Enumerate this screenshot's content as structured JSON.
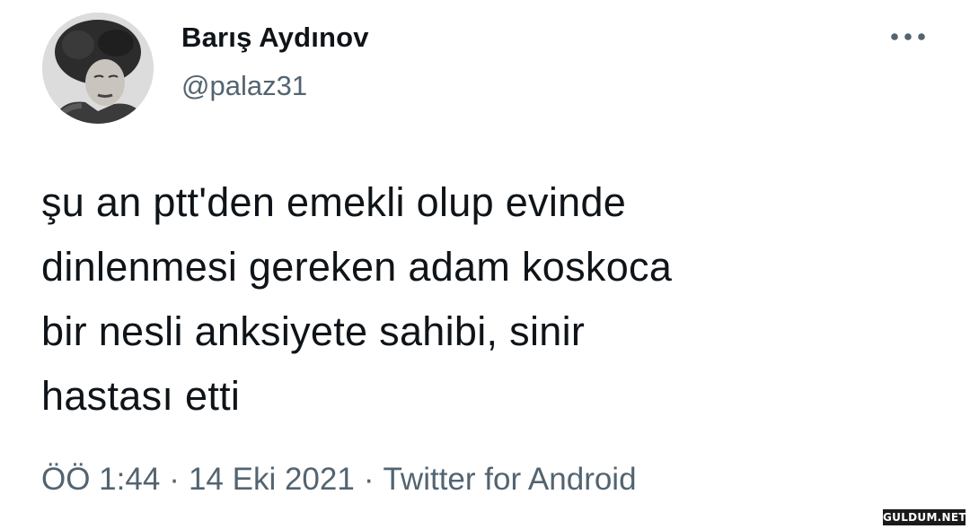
{
  "user": {
    "display_name": "Barış Aydınov",
    "handle": "@palaz31",
    "avatar_icon": "profile-photo"
  },
  "tweet": {
    "lines": [
      "şu an ptt'den emekli olup evinde",
      "dinlenmesi gereken adam koskoca",
      "bir nesli anksiyete sahibi, sinir",
      "hastası etti"
    ]
  },
  "meta": {
    "time": "ÖÖ 1:44",
    "separator": "·",
    "date": "14 Eki 2021",
    "source": "Twitter for Android"
  },
  "more_icon": "more-horizontal-icon",
  "watermark": "GULDUM.NET",
  "colors": {
    "text": "#0f1419",
    "secondary": "#536471",
    "background": "#ffffff"
  }
}
